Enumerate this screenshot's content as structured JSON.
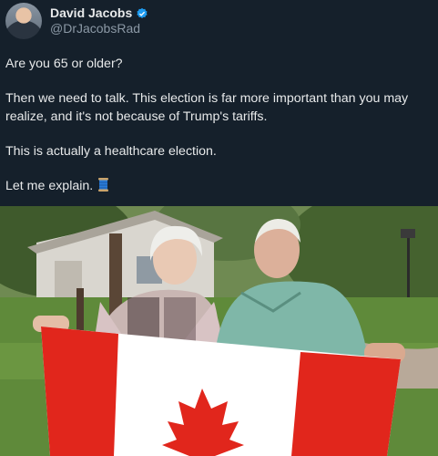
{
  "author": {
    "display_name": "David Jacobs",
    "handle": "@DrJacobsRad",
    "verified": true,
    "avatar_icon": "profile-avatar"
  },
  "tweet": {
    "paragraphs": [
      "Are you 65 or older?",
      "Then we need to talk. This election is far more important than you may realize, and it's not because of Trump's tariffs.",
      "This is actually a healthcare election.",
      "Let me explain."
    ],
    "trailing_emoji": "spool-of-thread-icon"
  },
  "photo": {
    "description_icon": "photo-elderly-couple-holding-canadian-flag"
  },
  "colors": {
    "background": "#15202b",
    "text": "#e7e9ea",
    "muted": "#8b98a5",
    "verified_blue": "#1d9bf0",
    "flag_red": "#e1261c"
  }
}
